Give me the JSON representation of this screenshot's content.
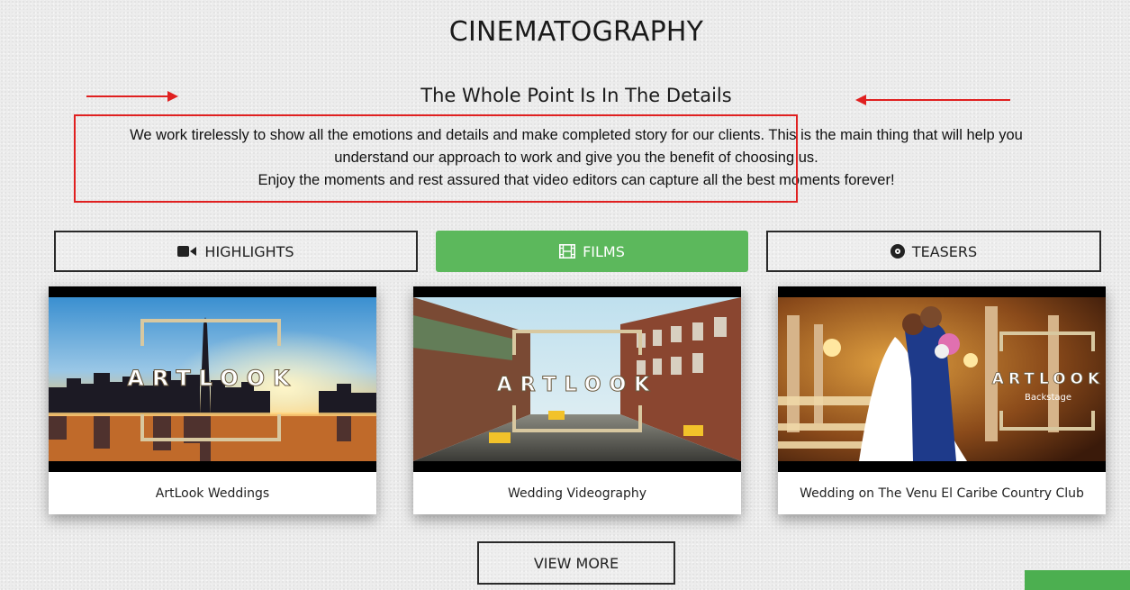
{
  "section": {
    "title": "CINEMATOGRAPHY",
    "subtitle": "The Whole Point Is In The Details",
    "paragraph_line1": "We work tirelessly to show all the emotions and details and make completed story for our clients. This is the main thing that will help you",
    "paragraph_line2": "understand our approach to work and give you the benefit of choosing us.",
    "paragraph_line3": "Enjoy the moments and rest assured that video editors can capture all the best moments forever!"
  },
  "tabs": [
    {
      "label": "HIGHLIGHTS",
      "icon": "video-camera-icon",
      "active": false
    },
    {
      "label": "FILMS",
      "icon": "film-icon",
      "active": true
    },
    {
      "label": "TEASERS",
      "icon": "disc-icon",
      "active": false
    }
  ],
  "cards": [
    {
      "caption": "ArtLook Weddings",
      "overlay_text": "ARTLOOK"
    },
    {
      "caption": "Wedding Videography",
      "overlay_text": "ARTLOOK"
    },
    {
      "caption": "Wedding on The Venu El Caribe Country Club",
      "overlay_text": "ARTLOOK",
      "overlay_subtext": "Backstage"
    }
  ],
  "view_more_label": "VIEW MORE",
  "colors": {
    "accent": "#5cb85c",
    "annotation": "#e02020",
    "background": "#ececec"
  }
}
